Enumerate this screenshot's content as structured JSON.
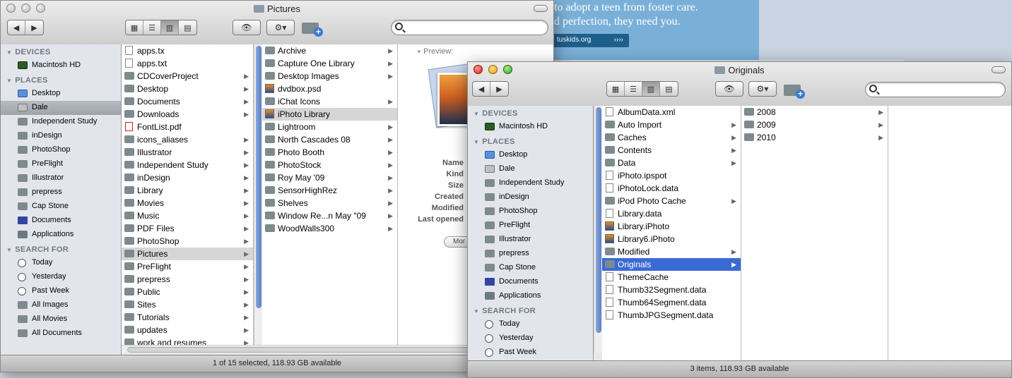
{
  "background_ad": {
    "line1": "to adopt a teen from foster care.",
    "line2": "d perfection, they need you.",
    "url": "tuskids.org",
    "arrows": "››››"
  },
  "win1": {
    "title": "Pictures",
    "nav_back": "◀",
    "nav_fwd": "▶",
    "view_icons": [
      "▦",
      "☰",
      "▥",
      "▤"
    ],
    "eye": "👁",
    "gear": "⚙▾",
    "sidebar": {
      "devices_header": "DEVICES",
      "devices": [
        {
          "label": "Macintosh HD",
          "icon": "hd"
        }
      ],
      "places_header": "PLACES",
      "places": [
        {
          "label": "Desktop",
          "icon": "desk"
        },
        {
          "label": "Dale",
          "icon": "home",
          "selected": true
        },
        {
          "label": "Independent Study",
          "icon": "folder"
        },
        {
          "label": "inDesign",
          "icon": "folder"
        },
        {
          "label": "PhotoShop",
          "icon": "folder"
        },
        {
          "label": "PreFlight",
          "icon": "folder"
        },
        {
          "label": "Illustrator",
          "icon": "folder"
        },
        {
          "label": "prepress",
          "icon": "folder"
        },
        {
          "label": "Cap Stone",
          "icon": "folder"
        },
        {
          "label": "Documents",
          "icon": "docs"
        },
        {
          "label": "Applications",
          "icon": "apps"
        }
      ],
      "search_header": "SEARCH FOR",
      "search": [
        {
          "label": "Today",
          "icon": "clock"
        },
        {
          "label": "Yesterday",
          "icon": "clock"
        },
        {
          "label": "Past Week",
          "icon": "clock"
        },
        {
          "label": "All Images",
          "icon": "folder"
        },
        {
          "label": "All Movies",
          "icon": "folder"
        },
        {
          "label": "All Documents",
          "icon": "folder"
        }
      ]
    },
    "col1": [
      {
        "label": "apps.tx",
        "icon": "doc"
      },
      {
        "label": "apps.txt",
        "icon": "doc"
      },
      {
        "label": "CDCoverProject",
        "icon": "folder",
        "arrow": true
      },
      {
        "label": "Desktop",
        "icon": "folder",
        "arrow": true
      },
      {
        "label": "Documents",
        "icon": "folder",
        "arrow": true
      },
      {
        "label": "Downloads",
        "icon": "folder",
        "arrow": true
      },
      {
        "label": "FontList.pdf",
        "icon": "pdf"
      },
      {
        "label": "icons_aliases",
        "icon": "folder",
        "arrow": true
      },
      {
        "label": "Illustrator",
        "icon": "folder",
        "arrow": true
      },
      {
        "label": "Independent Study",
        "icon": "folder",
        "arrow": true
      },
      {
        "label": "inDesign",
        "icon": "folder",
        "arrow": true
      },
      {
        "label": "Library",
        "icon": "folder",
        "arrow": true
      },
      {
        "label": "Movies",
        "icon": "folder",
        "arrow": true
      },
      {
        "label": "Music",
        "icon": "folder",
        "arrow": true
      },
      {
        "label": "PDF Files",
        "icon": "folder",
        "arrow": true
      },
      {
        "label": "PhotoShop",
        "icon": "folder",
        "arrow": true
      },
      {
        "label": "Pictures",
        "icon": "folder",
        "arrow": true,
        "selected": true
      },
      {
        "label": "PreFlight",
        "icon": "folder",
        "arrow": true
      },
      {
        "label": "prepress",
        "icon": "folder",
        "arrow": true
      },
      {
        "label": "Public",
        "icon": "folder",
        "arrow": true
      },
      {
        "label": "Sites",
        "icon": "folder",
        "arrow": true
      },
      {
        "label": "Tutorials",
        "icon": "folder",
        "arrow": true
      },
      {
        "label": "updates",
        "icon": "folder",
        "arrow": true
      },
      {
        "label": "work and resumes",
        "icon": "folder",
        "arrow": true
      }
    ],
    "col2": [
      {
        "label": "Archive",
        "icon": "folder",
        "arrow": true
      },
      {
        "label": "Capture One Library",
        "icon": "folder",
        "arrow": true
      },
      {
        "label": "Desktop Images",
        "icon": "folder",
        "arrow": true
      },
      {
        "label": "dvdbox.psd",
        "icon": "img"
      },
      {
        "label": "iChat Icons",
        "icon": "folder",
        "arrow": true
      },
      {
        "label": "iPhoto Library",
        "icon": "img",
        "selected": true
      },
      {
        "label": "Lightroom",
        "icon": "folder",
        "arrow": true
      },
      {
        "label": "North Cascades 08",
        "icon": "folder",
        "arrow": true
      },
      {
        "label": "Photo Booth",
        "icon": "folder",
        "arrow": true
      },
      {
        "label": "PhotoStock",
        "icon": "folder",
        "arrow": true
      },
      {
        "label": "Roy May '09",
        "icon": "folder",
        "arrow": true
      },
      {
        "label": "SensorHighRez",
        "icon": "folder",
        "arrow": true
      },
      {
        "label": "Shelves",
        "icon": "folder",
        "arrow": true
      },
      {
        "label": "Window Re...n May \"09",
        "icon": "folder",
        "arrow": true
      },
      {
        "label": "WoodWalls300",
        "icon": "folder",
        "arrow": true
      }
    ],
    "preview": {
      "label": "Preview:",
      "fields": [
        "Name",
        "Kind",
        "Size",
        "Created",
        "Modified",
        "Last opened"
      ],
      "more_button": "Mor"
    },
    "status": "1 of 15 selected, 118.93 GB available"
  },
  "win2": {
    "title": "Originals",
    "nav_back": "◀",
    "nav_fwd": "▶",
    "view_icons": [
      "▦",
      "☰",
      "▥",
      "▤"
    ],
    "eye": "👁",
    "gear": "⚙▾",
    "sidebar": {
      "devices_header": "DEVICES",
      "devices": [
        {
          "label": "Macintosh HD",
          "icon": "hd"
        }
      ],
      "places_header": "PLACES",
      "places": [
        {
          "label": "Desktop",
          "icon": "desk"
        },
        {
          "label": "Dale",
          "icon": "home"
        },
        {
          "label": "Independent Study",
          "icon": "folder"
        },
        {
          "label": "inDesign",
          "icon": "folder"
        },
        {
          "label": "PhotoShop",
          "icon": "folder"
        },
        {
          "label": "PreFlight",
          "icon": "folder"
        },
        {
          "label": "Illustrator",
          "icon": "folder"
        },
        {
          "label": "prepress",
          "icon": "folder"
        },
        {
          "label": "Cap Stone",
          "icon": "folder"
        },
        {
          "label": "Documents",
          "icon": "docs"
        },
        {
          "label": "Applications",
          "icon": "apps"
        }
      ],
      "search_header": "SEARCH FOR",
      "search": [
        {
          "label": "Today",
          "icon": "clock"
        },
        {
          "label": "Yesterday",
          "icon": "clock"
        },
        {
          "label": "Past Week",
          "icon": "clock"
        }
      ]
    },
    "col1": [
      {
        "label": "AlbumData.xml",
        "icon": "doc"
      },
      {
        "label": "Auto Import",
        "icon": "folder",
        "arrow": true
      },
      {
        "label": "Caches",
        "icon": "folder",
        "arrow": true
      },
      {
        "label": "Contents",
        "icon": "folder",
        "arrow": true
      },
      {
        "label": "Data",
        "icon": "folder",
        "arrow": true
      },
      {
        "label": "iPhoto.ipspot",
        "icon": "doc"
      },
      {
        "label": "iPhotoLock.data",
        "icon": "doc"
      },
      {
        "label": "iPod Photo Cache",
        "icon": "folder",
        "arrow": true
      },
      {
        "label": "Library.data",
        "icon": "doc"
      },
      {
        "label": "Library.iPhoto",
        "icon": "img"
      },
      {
        "label": "Library6.iPhoto",
        "icon": "img"
      },
      {
        "label": "Modified",
        "icon": "folder",
        "arrow": true
      },
      {
        "label": "Originals",
        "icon": "folder",
        "arrow": true,
        "selected_blue": true
      },
      {
        "label": "ThemeCache",
        "icon": "doc"
      },
      {
        "label": "Thumb32Segment.data",
        "icon": "doc"
      },
      {
        "label": "Thumb64Segment.data",
        "icon": "doc"
      },
      {
        "label": "ThumbJPGSegment.data",
        "icon": "doc"
      }
    ],
    "col2": [
      {
        "label": "2008",
        "icon": "folder",
        "arrow": true
      },
      {
        "label": "2009",
        "icon": "folder",
        "arrow": true
      },
      {
        "label": "2010",
        "icon": "folder",
        "arrow": true
      }
    ],
    "status": "3 items, 118.93 GB available"
  }
}
